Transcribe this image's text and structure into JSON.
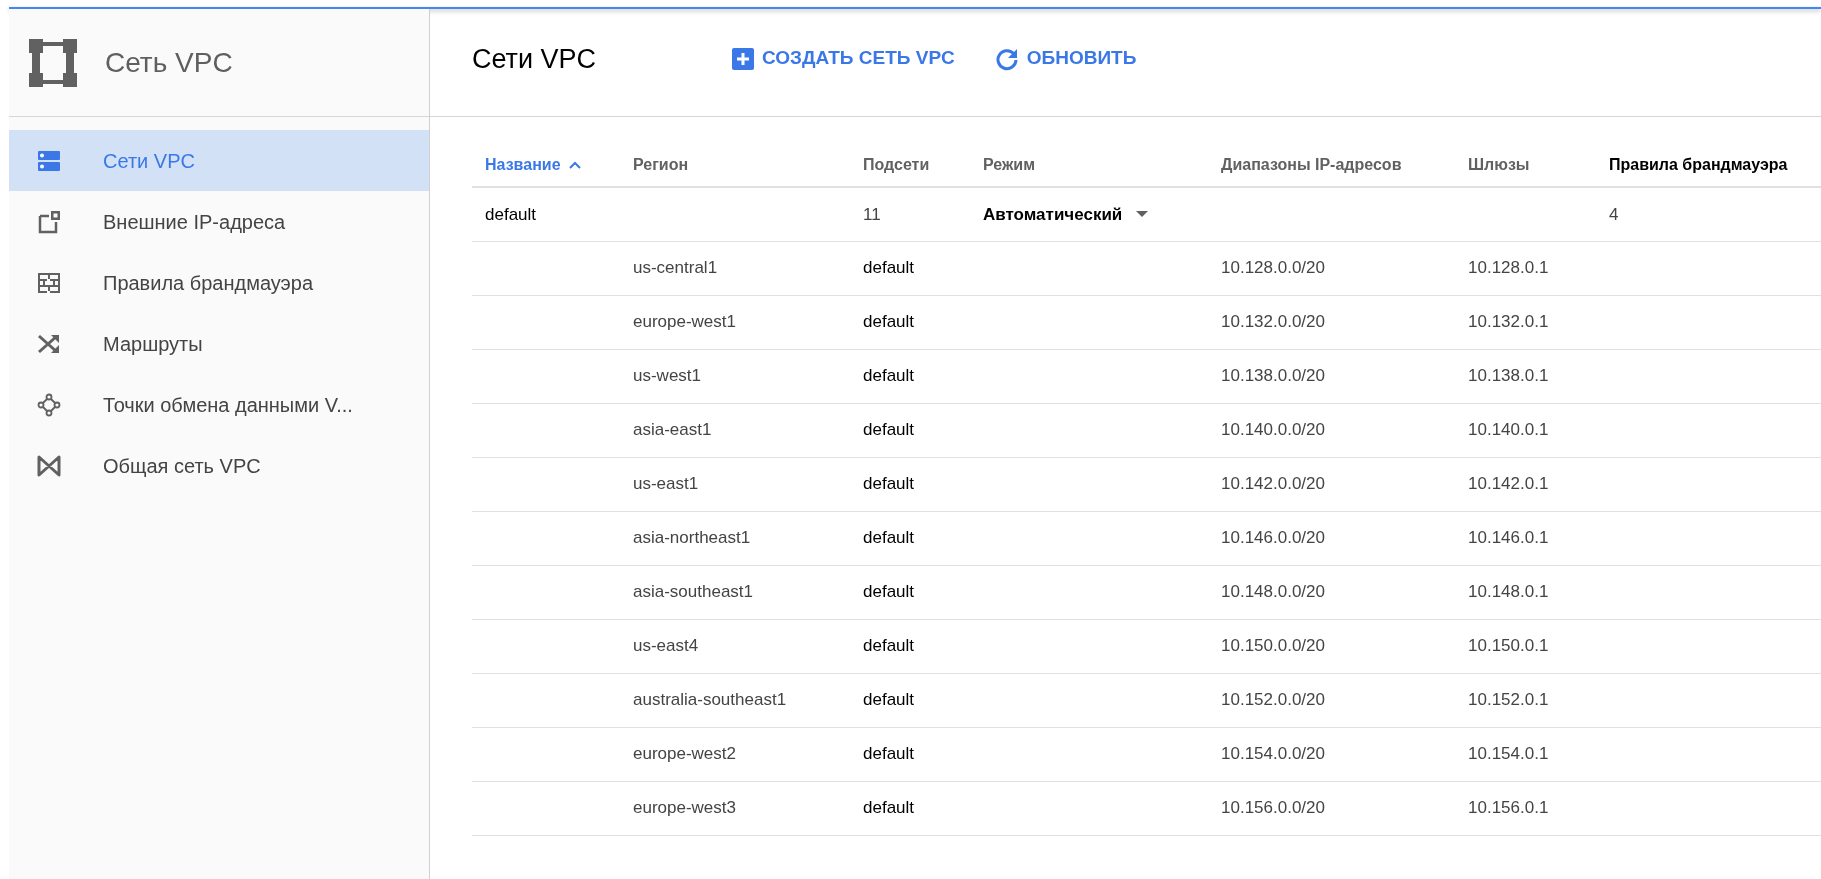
{
  "product": {
    "title": "Сеть VPC"
  },
  "sidebar": {
    "items": [
      {
        "label": "Сети VPC",
        "kind": "networks",
        "selected": true
      },
      {
        "label": "Внешние IP-адреса",
        "kind": "external",
        "selected": false
      },
      {
        "label": "Правила брандмауэра",
        "kind": "firewall",
        "selected": false
      },
      {
        "label": "Маршруты",
        "kind": "routes",
        "selected": false
      },
      {
        "label": "Точки обмена данными V...",
        "kind": "peering",
        "selected": false
      },
      {
        "label": "Общая сеть VPC",
        "kind": "shared",
        "selected": false
      }
    ]
  },
  "page": {
    "title": "Сети VPC",
    "actions": [
      {
        "label": "СОЗДАТЬ СЕТЬ VPC",
        "kind": "add"
      },
      {
        "label": "ОБНОВИТЬ",
        "kind": "refresh"
      }
    ]
  },
  "table": {
    "columns": [
      {
        "label": "Название",
        "sorted": true
      },
      {
        "label": "Регион",
        "sorted": false,
        "highlighted": false
      },
      {
        "label": "Подсети",
        "sorted": false,
        "highlighted": false
      },
      {
        "label": "Режим",
        "sorted": false,
        "highlighted": false
      },
      {
        "label": "Диапазоны IP-адресов",
        "sorted": false,
        "highlighted": false
      },
      {
        "label": "Шлюзы",
        "sorted": false,
        "highlighted": false
      },
      {
        "label": "Правила брандмауэра",
        "sorted": false,
        "highlighted": true
      }
    ],
    "rows": [
      {
        "kind": "network",
        "name": "default",
        "subnets": "11",
        "mode": "Автоматический",
        "firewall_rules": "4"
      },
      {
        "kind": "subnet",
        "region": "us-central1",
        "network": "default",
        "range": "10.128.0.0/20",
        "gateway": "10.128.0.1"
      },
      {
        "kind": "subnet",
        "region": "europe-west1",
        "network": "default",
        "range": "10.132.0.0/20",
        "gateway": "10.132.0.1"
      },
      {
        "kind": "subnet",
        "region": "us-west1",
        "network": "default",
        "range": "10.138.0.0/20",
        "gateway": "10.138.0.1"
      },
      {
        "kind": "subnet",
        "region": "asia-east1",
        "network": "default",
        "range": "10.140.0.0/20",
        "gateway": "10.140.0.1"
      },
      {
        "kind": "subnet",
        "region": "us-east1",
        "network": "default",
        "range": "10.142.0.0/20",
        "gateway": "10.142.0.1"
      },
      {
        "kind": "subnet",
        "region": "asia-northeast1",
        "network": "default",
        "range": "10.146.0.0/20",
        "gateway": "10.146.0.1"
      },
      {
        "kind": "subnet",
        "region": "asia-southeast1",
        "network": "default",
        "range": "10.148.0.0/20",
        "gateway": "10.148.0.1"
      },
      {
        "kind": "subnet",
        "region": "us-east4",
        "network": "default",
        "range": "10.150.0.0/20",
        "gateway": "10.150.0.1"
      },
      {
        "kind": "subnet",
        "region": "australia-southeast1",
        "network": "default",
        "range": "10.152.0.0/20",
        "gateway": "10.152.0.1"
      },
      {
        "kind": "subnet",
        "region": "europe-west2",
        "network": "default",
        "range": "10.154.0.0/20",
        "gateway": "10.154.0.1"
      },
      {
        "kind": "subnet",
        "region": "europe-west3",
        "network": "default",
        "range": "10.156.0.0/20",
        "gateway": "10.156.0.1"
      }
    ]
  }
}
